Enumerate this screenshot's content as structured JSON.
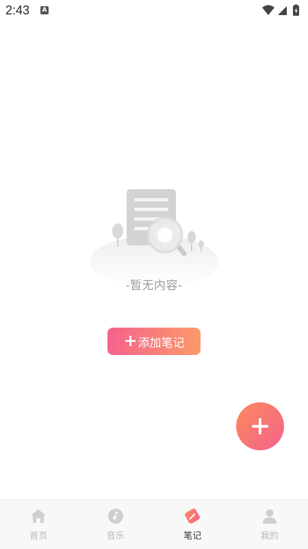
{
  "status_bar": {
    "time": "2:43",
    "notification_icon_letter": "A"
  },
  "empty_state": {
    "message": "-暂无内容-"
  },
  "add_note_button": {
    "plus": "+",
    "label": "添加笔记"
  },
  "bottom_nav": {
    "active": "note",
    "items": [
      {
        "key": "home",
        "label": "首页",
        "icon": "home-icon"
      },
      {
        "key": "music",
        "label": "音乐",
        "icon": "music-disc-icon"
      },
      {
        "key": "note",
        "label": "笔记",
        "icon": "pencil-icon"
      },
      {
        "key": "mine",
        "label": "我的",
        "icon": "user-icon"
      }
    ]
  },
  "colors": {
    "accent_start": "#f5628c",
    "accent_end": "#fb9a6b",
    "inactive_nav": "#c8c8c8",
    "active_nav_text": "#333333"
  }
}
